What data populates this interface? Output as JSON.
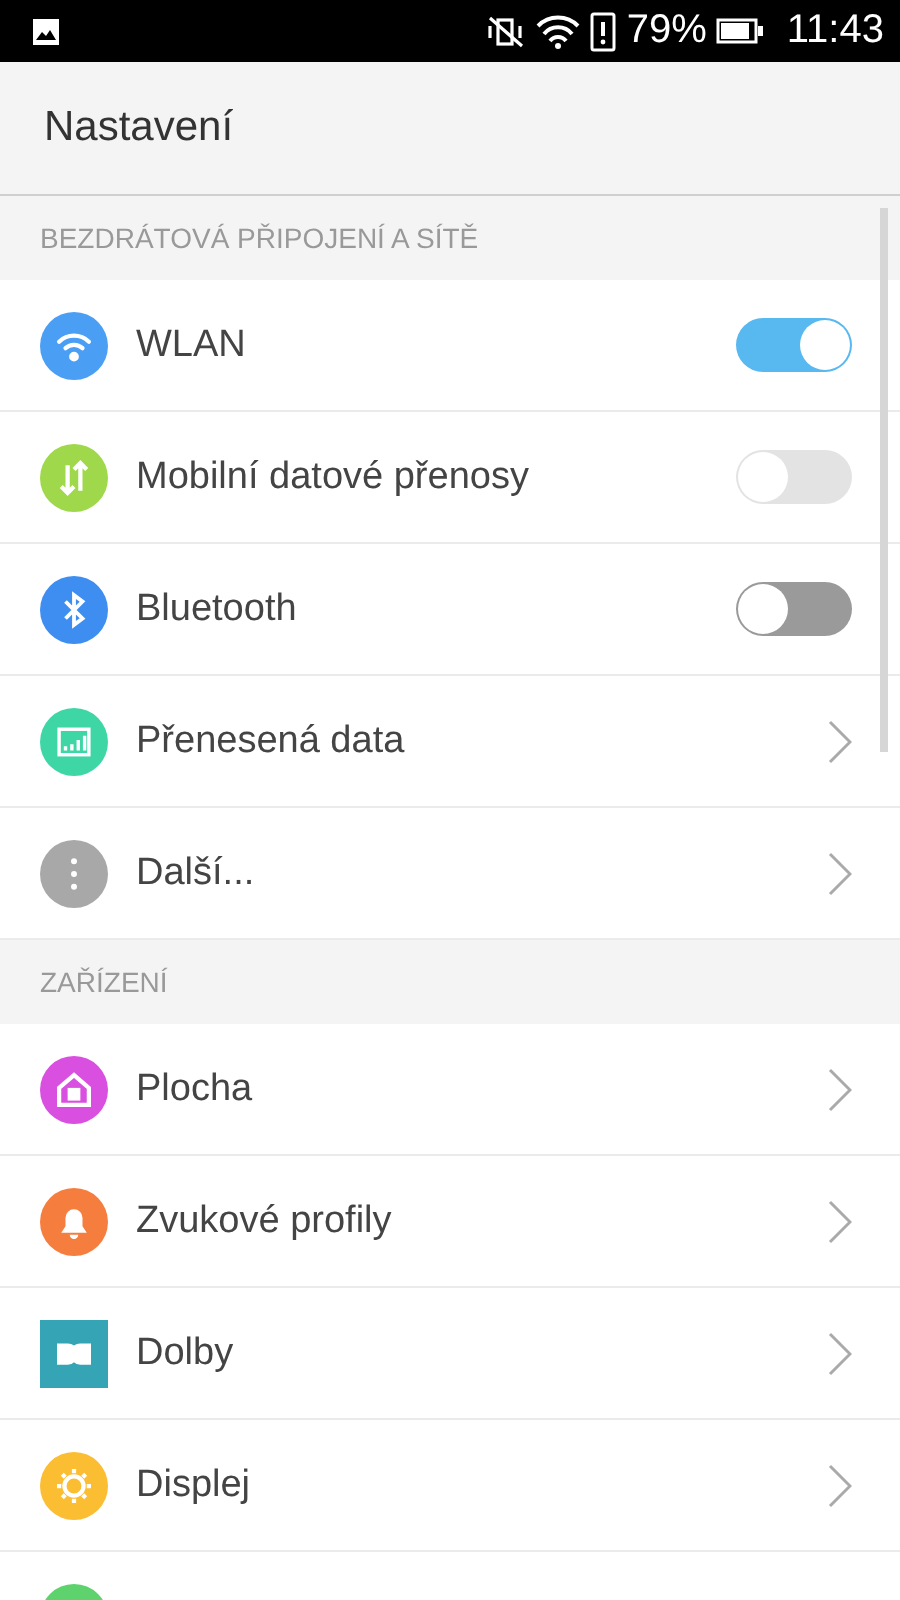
{
  "status_bar": {
    "battery_text": "79%",
    "time": "11:43"
  },
  "header": {
    "title": "Nastavení"
  },
  "sections": [
    {
      "title": "BEZDRÁTOVÁ PŘIPOJENÍ A SÍTĚ",
      "items": [
        {
          "kind": "toggle",
          "label": "WLAN",
          "on": true,
          "disabled": false
        },
        {
          "kind": "toggle",
          "label": "Mobilní datové přenosy",
          "on": false,
          "disabled": true
        },
        {
          "kind": "toggle",
          "label": "Bluetooth",
          "on": false,
          "disabled": false
        },
        {
          "kind": "link",
          "label": "Přenesená data"
        },
        {
          "kind": "link",
          "label": "Další..."
        }
      ]
    },
    {
      "title": "ZAŘÍZENÍ",
      "items": [
        {
          "kind": "link",
          "label": "Plocha"
        },
        {
          "kind": "link",
          "label": "Zvukové profily"
        },
        {
          "kind": "link",
          "label": "Dolby"
        },
        {
          "kind": "link",
          "label": "Displej"
        },
        {
          "kind": "partial"
        }
      ]
    }
  ]
}
